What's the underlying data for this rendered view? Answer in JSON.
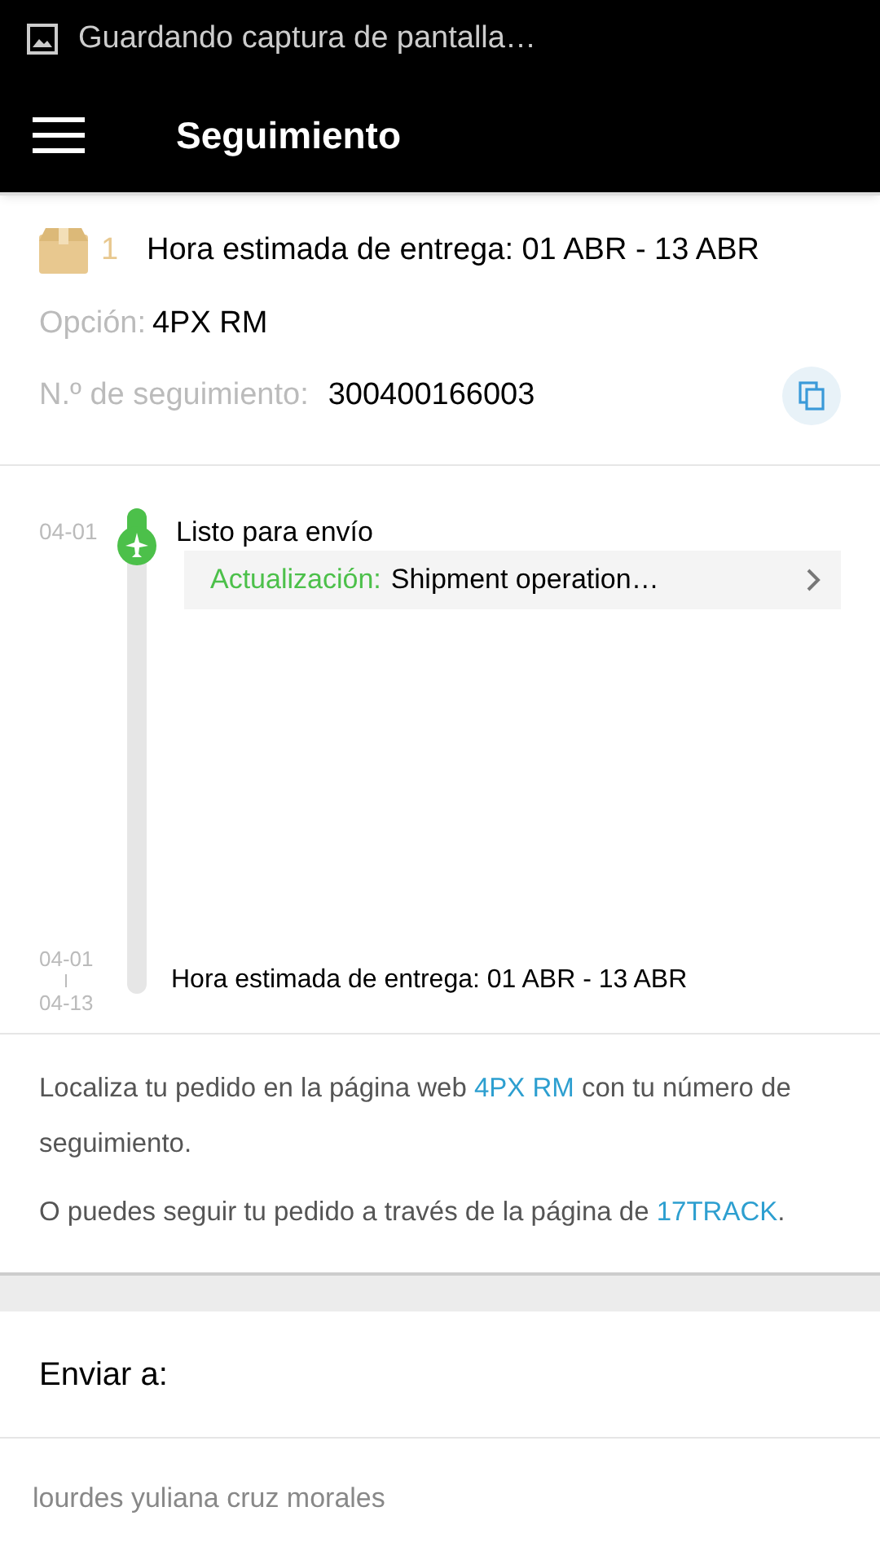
{
  "notification": {
    "text": "Guardando captura de pantalla…"
  },
  "app_bar": {
    "title": "Seguimiento"
  },
  "package": {
    "count": "1",
    "estimate": "Hora estimada de entrega: 01 ABR - 13 ABR",
    "option_label": "Opción:",
    "option_value": "4PX RM",
    "tracking_label": "N.º de seguimiento:",
    "tracking_number": "300400166003"
  },
  "timeline": [
    {
      "kind": "event",
      "date": "04-01",
      "title": "Listo para envío",
      "update_label": "Actualización:",
      "update_text": "Shipment operation…"
    },
    {
      "kind": "estimate",
      "date_from": "04-01",
      "date_to": "04-13",
      "title": "Hora estimada de entrega: 01 ABR - 13 ABR"
    }
  ],
  "info": [
    {
      "before": "Localiza tu pedido en la página web ",
      "link": "4PX RM",
      "after": " con tu número de seguimiento."
    },
    {
      "before": "O puedes seguir tu pedido a través de la página de ",
      "link": "17TRACK",
      "after": "."
    }
  ],
  "ship_to": {
    "title": "Enviar a:",
    "name": "lourdes yuliana cruz morales"
  }
}
